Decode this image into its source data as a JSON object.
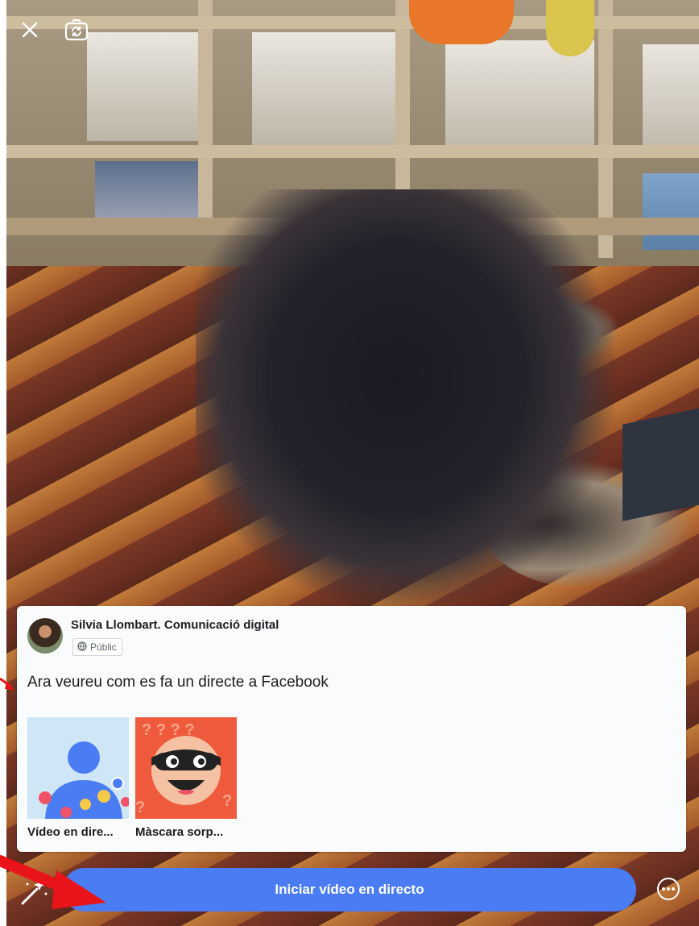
{
  "top_bar": {
    "close_icon": "close-icon",
    "flip_camera_icon": "flip-camera-icon"
  },
  "composer": {
    "page_name": "Silvia Llombart. Comunicació digital",
    "privacy": "Públic",
    "privacy_icon": "globe-icon",
    "post_text": "Ara veureu com es fa un directe a Facebook"
  },
  "effects": [
    {
      "label": "Vídeo en dire...",
      "icon": "live-reactions-thumbnail"
    },
    {
      "label": "Màscara sorp...",
      "icon": "surprise-mask-thumbnail"
    }
  ],
  "bottom_bar": {
    "go_live_label": "Iniciar vídeo en directo",
    "magic_icon": "magic-wand-icon",
    "more_icon": "more-options-icon"
  },
  "colors": {
    "accent": "#4a7cf3",
    "annotation_arrow": "#e8141a"
  }
}
